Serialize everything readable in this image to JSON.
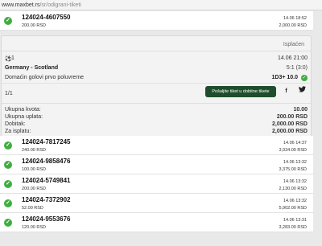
{
  "browser": {
    "host": "www.maxbet.rs",
    "path": "/sr/odigrani-tiketi"
  },
  "top_ticket": {
    "id": "124024-4607550",
    "stake": "200.00 RSD",
    "date": "14.06 18:52",
    "win": "2,000.00 RSD"
  },
  "detail": {
    "status": "Isplaćen",
    "event_number": "1",
    "event_time": "14.06 21:00",
    "match": "Germany - Scotland",
    "score": "5:1 (3:0)",
    "market": "Domaćin golovi prvo poluvreme",
    "pick": "1D3+ 10.0",
    "count": "1/1",
    "send_button": "Pošaljite tiket u dobitne tikete",
    "facebook": "f",
    "twitter": "🐦",
    "summary": [
      {
        "label": "Ukupna kvota:",
        "value": "10.00"
      },
      {
        "label": "Ukupna uplata:",
        "value": "200.00 RSD"
      },
      {
        "label": "Dobitak:",
        "value": "2,000.00 RSD"
      },
      {
        "label": "Za isplatu:",
        "value": "2,000.00 RSD"
      }
    ]
  },
  "tickets": [
    {
      "id": "124024-7817245",
      "stake": "240.00 RSD",
      "date": "14.06 14:37",
      "win": "3,934.00 RSD"
    },
    {
      "id": "124024-9858476",
      "stake": "100.00 RSD",
      "date": "14.06 13:32",
      "win": "3,375.00 RSD"
    },
    {
      "id": "124024-5749841",
      "stake": "200.00 RSD",
      "date": "14.06 13:32",
      "win": "2,130.00 RSD"
    },
    {
      "id": "124024-7372902",
      "stake": "52.00 RSD",
      "date": "14.06 13:32",
      "win": "5,902.00 RSD"
    },
    {
      "id": "124024-9553676",
      "stake": "120.00 RSD",
      "date": "14.06 13:31",
      "win": "3,283.00 RSD"
    }
  ],
  "colors": {
    "success": "#3fae3f",
    "button": "#1e4d2b"
  }
}
